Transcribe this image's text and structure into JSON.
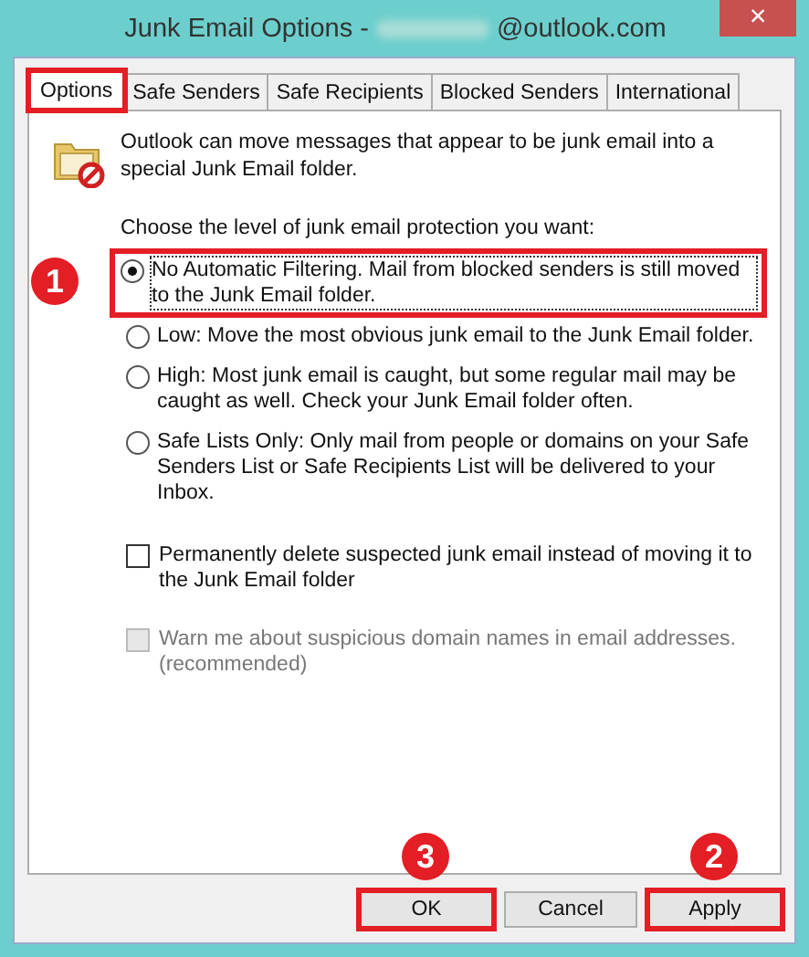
{
  "window": {
    "title_prefix": "Junk Email Options -",
    "title_suffix": "@outlook.com",
    "close": "×"
  },
  "tabs": [
    {
      "label": "Options",
      "selected": true,
      "highlighted": true
    },
    {
      "label": "Safe Senders",
      "selected": false,
      "highlighted": false
    },
    {
      "label": "Safe Recipients",
      "selected": false,
      "highlighted": false
    },
    {
      "label": "Blocked Senders",
      "selected": false,
      "highlighted": false
    },
    {
      "label": "International",
      "selected": false,
      "highlighted": false
    }
  ],
  "intro": "Outlook can move messages that appear to be junk email into a special Junk Email folder.",
  "prompt": "Choose the level of junk email protection you want:",
  "levels": [
    {
      "label": "No Automatic Filtering. Mail from blocked senders is still moved to the Junk Email folder.",
      "selected": true,
      "highlighted": true,
      "marker": "1"
    },
    {
      "label": "Low: Move the most obvious junk email to the Junk Email folder.",
      "selected": false,
      "highlighted": false
    },
    {
      "label": "High: Most junk email is caught, but some regular mail may be caught as well. Check your Junk Email folder often.",
      "selected": false,
      "highlighted": false
    },
    {
      "label": "Safe Lists Only: Only mail from people or domains on your Safe Senders List or Safe Recipients List will be delivered to your Inbox.",
      "selected": false,
      "highlighted": false
    }
  ],
  "checkboxes": [
    {
      "label": "Permanently delete suspected junk email instead of moving it to the Junk Email folder",
      "checked": false,
      "disabled": false
    },
    {
      "label": "Warn me about suspicious domain names in email addresses. (recommended)",
      "checked": false,
      "disabled": true
    }
  ],
  "buttons": [
    {
      "label": "OK",
      "highlighted": true,
      "marker": "3"
    },
    {
      "label": "Cancel",
      "highlighted": false
    },
    {
      "label": "Apply",
      "highlighted": true,
      "marker": "2"
    }
  ]
}
